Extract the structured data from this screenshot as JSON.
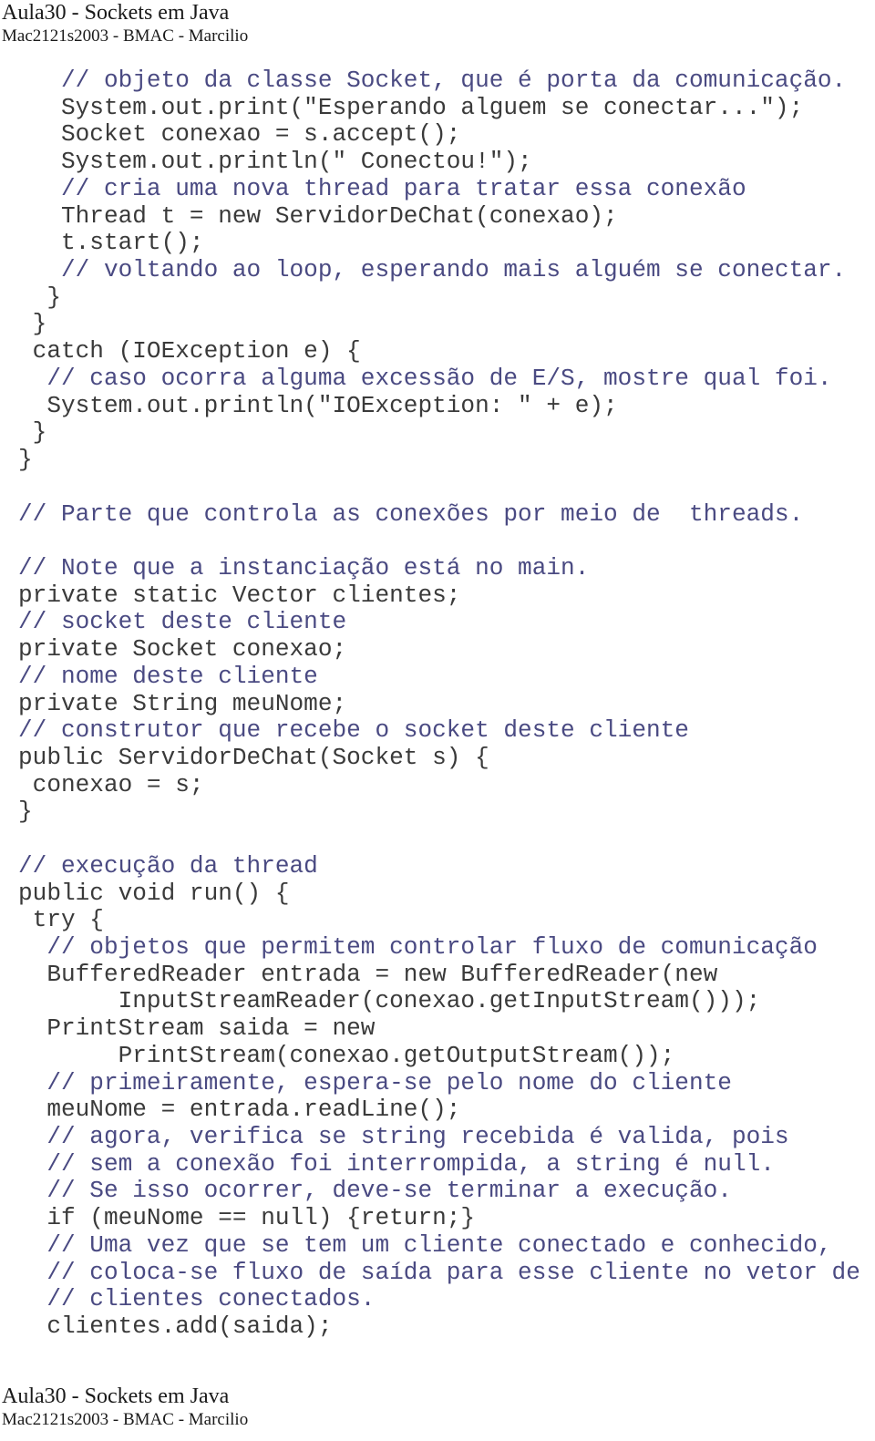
{
  "header": {
    "title": "Aula30 - Sockets em Java",
    "subtitle": "Mac2121s2003 - BMAC - Marcilio"
  },
  "footer": {
    "title": "Aula30 - Sockets em Java",
    "subtitle": "Mac2121s2003 - BMAC - Marcilio"
  },
  "colors": {
    "code_text": "#3a3a3a",
    "comment_text": "#4a4a82",
    "background": "#ffffff"
  },
  "code_lines": [
    {
      "type": "comment",
      "text": "   // objeto da classe Socket, que é porta da comunicação."
    },
    {
      "type": "code",
      "text": "   System.out.print(\"Esperando alguem se conectar...\");"
    },
    {
      "type": "code",
      "text": "   Socket conexao = s.accept();"
    },
    {
      "type": "code",
      "text": "   System.out.println(\" Conectou!\");"
    },
    {
      "type": "comment",
      "text": "   // cria uma nova thread para tratar essa conexão"
    },
    {
      "type": "code",
      "text": "   Thread t = new ServidorDeChat(conexao);"
    },
    {
      "type": "code",
      "text": "   t.start();"
    },
    {
      "type": "comment",
      "text": "   // voltando ao loop, esperando mais alguém se conectar."
    },
    {
      "type": "code",
      "text": "  }"
    },
    {
      "type": "code",
      "text": " }"
    },
    {
      "type": "code",
      "text": " catch (IOException e) {"
    },
    {
      "type": "comment",
      "text": "  // caso ocorra alguma excessão de E/S, mostre qual foi."
    },
    {
      "type": "code",
      "text": "  System.out.println(\"IOException: \" + e);"
    },
    {
      "type": "code",
      "text": " }"
    },
    {
      "type": "code",
      "text": "}"
    },
    {
      "type": "code",
      "text": ""
    },
    {
      "type": "comment",
      "text": "// Parte que controla as conexões por meio de  threads."
    },
    {
      "type": "code",
      "text": ""
    },
    {
      "type": "comment",
      "text": "// Note que a instanciação está no main."
    },
    {
      "type": "code",
      "text": "private static Vector clientes;"
    },
    {
      "type": "comment",
      "text": "// socket deste cliente"
    },
    {
      "type": "code",
      "text": "private Socket conexao;"
    },
    {
      "type": "comment",
      "text": "// nome deste cliente"
    },
    {
      "type": "code",
      "text": "private String meuNome;"
    },
    {
      "type": "comment",
      "text": "// construtor que recebe o socket deste cliente"
    },
    {
      "type": "code",
      "text": "public ServidorDeChat(Socket s) {"
    },
    {
      "type": "code",
      "text": " conexao = s;"
    },
    {
      "type": "code",
      "text": "}"
    },
    {
      "type": "code",
      "text": ""
    },
    {
      "type": "comment",
      "text": "// execução da thread"
    },
    {
      "type": "code",
      "text": "public void run() {"
    },
    {
      "type": "code",
      "text": " try {"
    },
    {
      "type": "comment",
      "text": "  // objetos que permitem controlar fluxo de comunicação"
    },
    {
      "type": "code",
      "text": "  BufferedReader entrada = new BufferedReader(new"
    },
    {
      "type": "code",
      "text": "       InputStreamReader(conexao.getInputStream()));"
    },
    {
      "type": "code",
      "text": "  PrintStream saida = new"
    },
    {
      "type": "code",
      "text": "       PrintStream(conexao.getOutputStream());"
    },
    {
      "type": "comment",
      "text": "  // primeiramente, espera-se pelo nome do cliente"
    },
    {
      "type": "code",
      "text": "  meuNome = entrada.readLine();"
    },
    {
      "type": "comment",
      "text": "  // agora, verifica se string recebida é valida, pois"
    },
    {
      "type": "comment",
      "text": "  // sem a conexão foi interrompida, a string é null."
    },
    {
      "type": "comment",
      "text": "  // Se isso ocorrer, deve-se terminar a execução."
    },
    {
      "type": "code",
      "text": "  if (meuNome == null) {return;}"
    },
    {
      "type": "comment",
      "text": "  // Uma vez que se tem um cliente conectado e conhecido,"
    },
    {
      "type": "comment",
      "text": "  // coloca-se fluxo de saída para esse cliente no vetor de"
    },
    {
      "type": "comment",
      "text": "  // clientes conectados."
    },
    {
      "type": "code",
      "text": "  clientes.add(saida);"
    }
  ]
}
